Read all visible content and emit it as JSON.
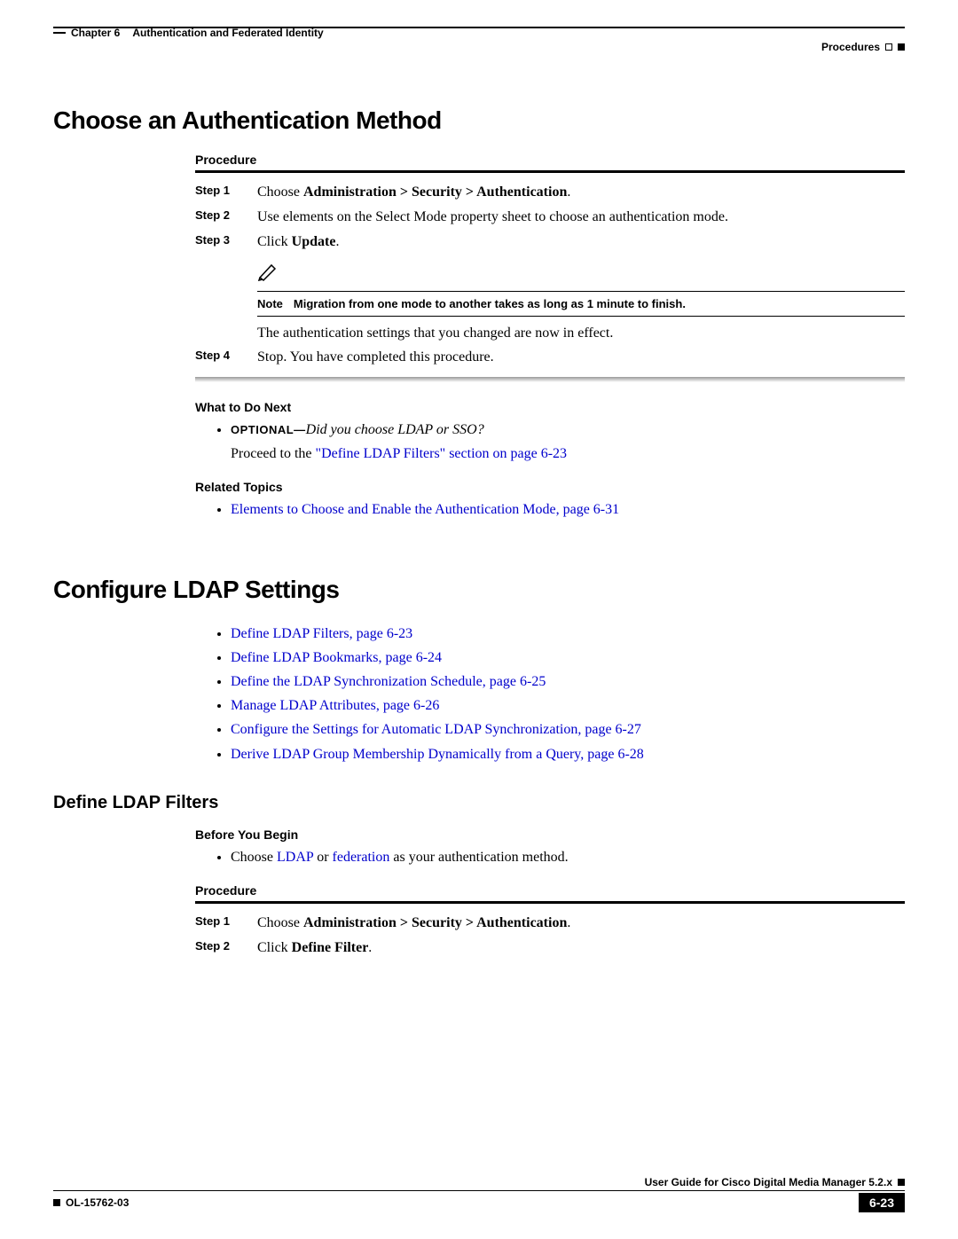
{
  "header": {
    "chapter_label": "Chapter 6",
    "chapter_title": "Authentication and Federated Identity",
    "breadcrumb_right": "Procedures"
  },
  "section1": {
    "title": "Choose an Authentication Method",
    "procedure_label": "Procedure",
    "steps": {
      "s1_label": "Step 1",
      "s1_prefix": "Choose ",
      "s1_bold": "Administration > Security > Authentication",
      "s1_suffix": ".",
      "s2_label": "Step 2",
      "s2_text": "Use elements on the Select Mode property sheet to choose an authentication mode.",
      "s3_label": "Step 3",
      "s3_prefix": "Click ",
      "s3_bold": "Update",
      "s3_suffix": ".",
      "note_label": "Note",
      "note_text": "Migration from one mode to another takes as long as 1 minute to finish.",
      "after_note": "The authentication settings that you changed are now in effect.",
      "s4_label": "Step 4",
      "s4_text": "Stop. You have completed this procedure."
    },
    "what_next_label": "What to Do Next",
    "optional_label": "OPTIONAL—",
    "optional_italic": "Did you choose LDAP or SSO?",
    "proceed_text": "Proceed to the ",
    "proceed_link": "\"Define LDAP Filters\" section on page 6-23",
    "related_label": "Related Topics",
    "related_link": "Elements to Choose and Enable the Authentication Mode, page 6-31"
  },
  "section2": {
    "title": "Configure LDAP Settings",
    "links": {
      "l1": "Define LDAP Filters, page 6-23",
      "l2": "Define LDAP Bookmarks, page 6-24",
      "l3": "Define the LDAP Synchronization Schedule, page 6-25",
      "l4": "Manage LDAP Attributes, page 6-26",
      "l5": "Configure the Settings for Automatic LDAP Synchronization, page 6-27",
      "l6": "Derive LDAP Group Membership Dynamically from a Query, page 6-28"
    },
    "sub_title": "Define LDAP Filters",
    "before_label": "Before You Begin",
    "before_prefix": "Choose ",
    "before_link1": "LDAP",
    "before_mid": " or ",
    "before_link2": "federation",
    "before_suffix": " as your authentication method.",
    "procedure_label": "Procedure",
    "steps": {
      "s1_label": "Step 1",
      "s1_prefix": "Choose ",
      "s1_bold": "Administration > Security > Authentication",
      "s1_suffix": ".",
      "s2_label": "Step 2",
      "s2_prefix": "Click ",
      "s2_bold": "Define Filter",
      "s2_suffix": "."
    }
  },
  "footer": {
    "guide_title": "User Guide for Cisco Digital Media Manager 5.2.x",
    "doc_id": "OL-15762-03",
    "page_num": "6-23"
  }
}
